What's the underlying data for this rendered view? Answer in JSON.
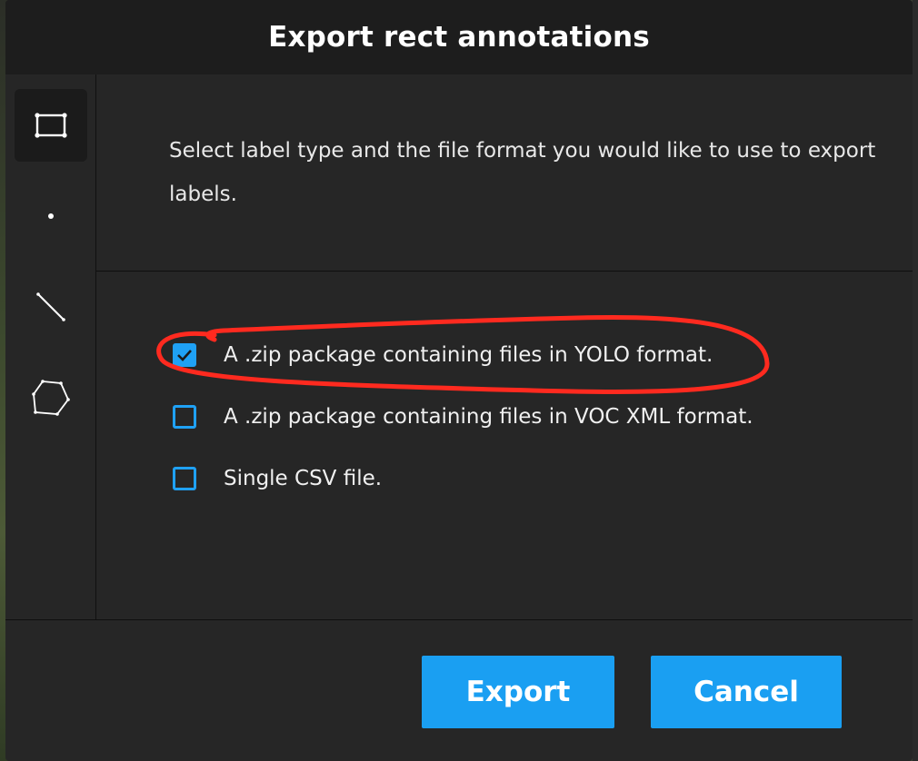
{
  "dialog": {
    "title": "Export rect annotations"
  },
  "sidebar": {
    "tools": [
      {
        "name": "rect",
        "icon": "rectangle-icon",
        "active": true
      },
      {
        "name": "point",
        "icon": "point-icon",
        "active": false
      },
      {
        "name": "line",
        "icon": "line-icon",
        "active": false
      },
      {
        "name": "polygon",
        "icon": "polygon-icon",
        "active": false
      }
    ]
  },
  "content": {
    "description": "Select label type and the file format you would like to use to export labels.",
    "options": [
      {
        "label": "A .zip package containing files in YOLO format.",
        "checked": true
      },
      {
        "label": "A .zip package containing files in VOC XML format.",
        "checked": false
      },
      {
        "label": "Single CSV file.",
        "checked": false
      }
    ]
  },
  "footer": {
    "export_label": "Export",
    "cancel_label": "Cancel"
  },
  "colors": {
    "accent": "#1fa1f5",
    "annotation": "#ff2a1f",
    "dialog_bg": "#262626",
    "header_bg": "#1d1d1d"
  }
}
